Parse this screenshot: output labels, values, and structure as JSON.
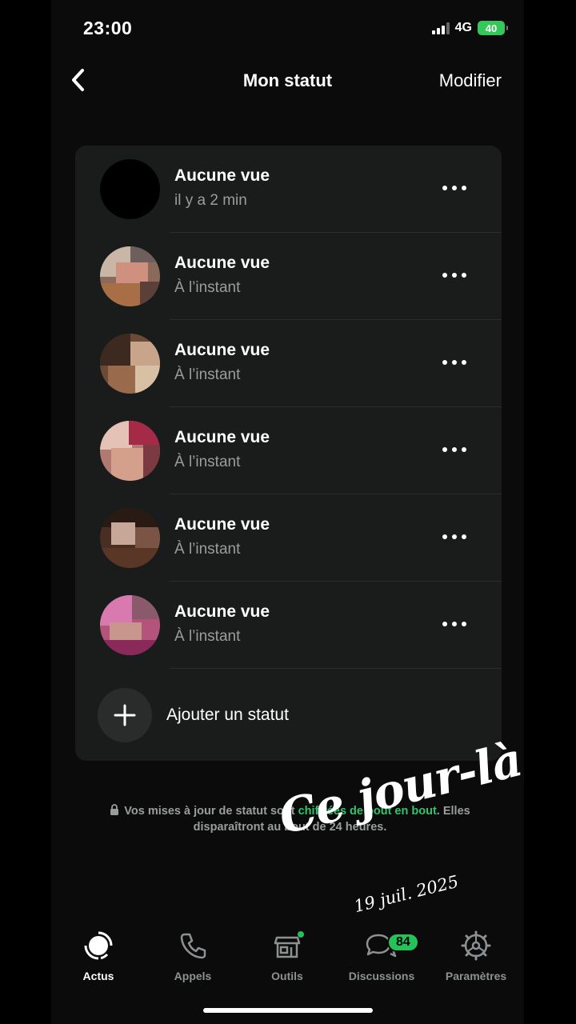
{
  "status_bar": {
    "time": "23:00",
    "network": "4G",
    "battery": "40"
  },
  "nav": {
    "title": "Mon statut",
    "edit_label": "Modifier"
  },
  "statuses": [
    {
      "title": "Aucune vue",
      "time": "il y a 2 min"
    },
    {
      "title": "Aucune vue",
      "time": "À l’instant"
    },
    {
      "title": "Aucune vue",
      "time": "À l’instant"
    },
    {
      "title": "Aucune vue",
      "time": "À l’instant"
    },
    {
      "title": "Aucune vue",
      "time": "À l’instant"
    },
    {
      "title": "Aucune vue",
      "time": "À l’instant"
    }
  ],
  "add_status": {
    "label": "Ajouter un statut"
  },
  "note": {
    "prefix": "Vos mises à jour de statut sont ",
    "highlight": "chiffrées de bout en bout",
    "suffix": ". Elles disparaîtront au bout de 24 heures."
  },
  "memory": {
    "title": "Ce jour-là",
    "date": "19 juil. 2025"
  },
  "tabs": [
    {
      "label": "Actus",
      "icon": "status-icon",
      "active": true
    },
    {
      "label": "Appels",
      "icon": "phone-icon"
    },
    {
      "label": "Outils",
      "icon": "store-icon"
    },
    {
      "label": "Discussions",
      "icon": "chat-icon",
      "badge": "84"
    },
    {
      "label": "Paramètres",
      "icon": "gear-icon"
    }
  ],
  "colors": {
    "accent": "#25c159",
    "background": "#0b0b0b",
    "card": "#1a1c1c"
  }
}
